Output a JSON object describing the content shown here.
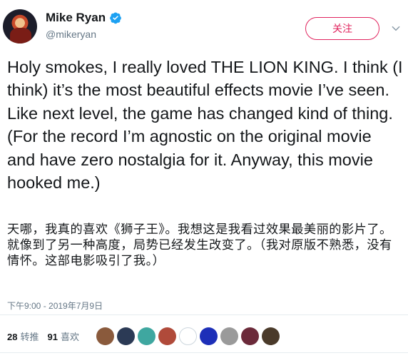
{
  "author": {
    "name": "Mike Ryan",
    "handle": "@mikeryan"
  },
  "follow_button": {
    "label": "关注"
  },
  "tweet": {
    "text": "Holy smokes, I really loved THE LION KING. I think (I think) it’s the most beautiful effects movie I’ve seen. Like next level, the game has changed kind of thing. (For the record I’m agnostic on the original movie and have zero nostalgia for it. Anyway, this movie hooked me.)",
    "translation": "天哪，我真的喜欢《狮子王》。我想这是我看过效果最美丽的影片了。就像到了另一种高度，局势已经发生改变了。（我对原版不熟悉，没有情怀。这部电影吸引了我。）",
    "timestamp": "下午9:00 - 2019年7月9日"
  },
  "stats": {
    "retweets": {
      "count": "28",
      "label": "转推"
    },
    "likes": {
      "count": "91",
      "label": "喜欢"
    }
  },
  "icons": {
    "verified": "verified-badge-icon",
    "caret": "chevron-down-icon"
  },
  "colors": {
    "accent_red": "#e0245e",
    "verified_blue": "#1da1f2",
    "secondary_text": "#657786"
  },
  "liker_avatars": [
    {
      "color": "#8a5a3c"
    },
    {
      "color": "#2b3a55"
    },
    {
      "color": "#3fa7a0"
    },
    {
      "color": "#b04a3a"
    },
    {
      "color": "#ffffff"
    },
    {
      "color": "#1d2fb8"
    },
    {
      "color": "#9a9a9a"
    },
    {
      "color": "#6b2a3a"
    },
    {
      "color": "#4a3a2a"
    }
  ]
}
